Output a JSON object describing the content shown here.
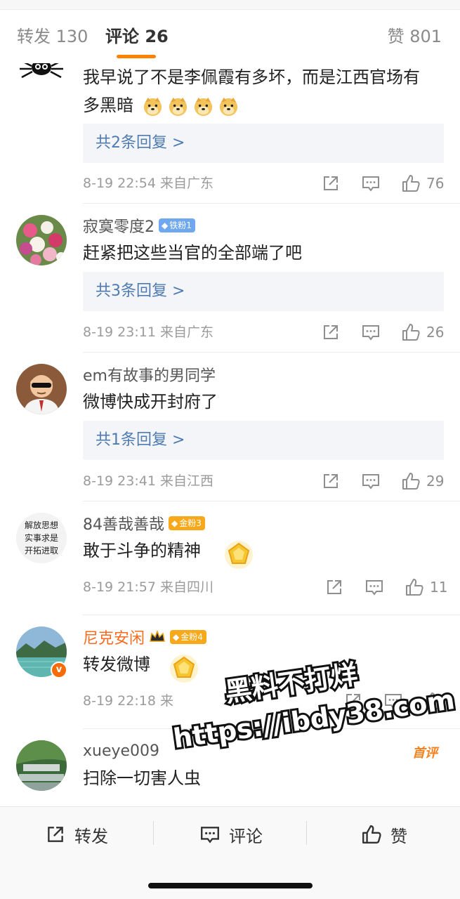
{
  "tabs": {
    "repost": "转发 130",
    "comment": "评论 26",
    "like": "赞 801"
  },
  "comments": [
    {
      "username": "",
      "text_line1": "我早说了不是李佩霞有多坏，而是江西官场有",
      "text_line2": "多黑暗",
      "replies": "共2条回复 >",
      "meta": "8-19 22:54  来自广东",
      "likes": "76"
    },
    {
      "username": "寂寞零度2",
      "fan_badge": "铁粉1",
      "text": "赶紧把这些当官的全部端了吧",
      "replies": "共3条回复 >",
      "meta": "8-19 23:11  来自广东",
      "likes": "26"
    },
    {
      "username": "em有故事的男同学",
      "text": "微博快成开封府了",
      "replies": "共1条回复 >",
      "meta": "8-19 23:41  来自江西",
      "likes": "29"
    },
    {
      "username": "84善哉善哉",
      "fan_badge": "金粉3",
      "avatar_text": [
        "解放思想",
        "实事求是",
        "开拓进取"
      ],
      "text": "敢于斗争的精神",
      "meta": "8-19 21:57  来自四川",
      "likes": "11"
    },
    {
      "username": "尼克安闲",
      "fan_badge": "金粉4",
      "verified_mark": "v",
      "text": "转发微博",
      "meta": "8-19 22:18  来",
      "likes": ""
    },
    {
      "username": "xueye009",
      "first_tag": "首评",
      "text": "扫除一切害人虫"
    }
  ],
  "bottom_bar": {
    "repost": "转发",
    "comment": "评论",
    "like": "赞"
  },
  "watermark": {
    "line1": "黑料不打烊",
    "line2": "https://ibdy38.com"
  },
  "colors": {
    "accent": "#ff8200",
    "link": "#4f7bb1",
    "meta": "#9b9b9b"
  }
}
